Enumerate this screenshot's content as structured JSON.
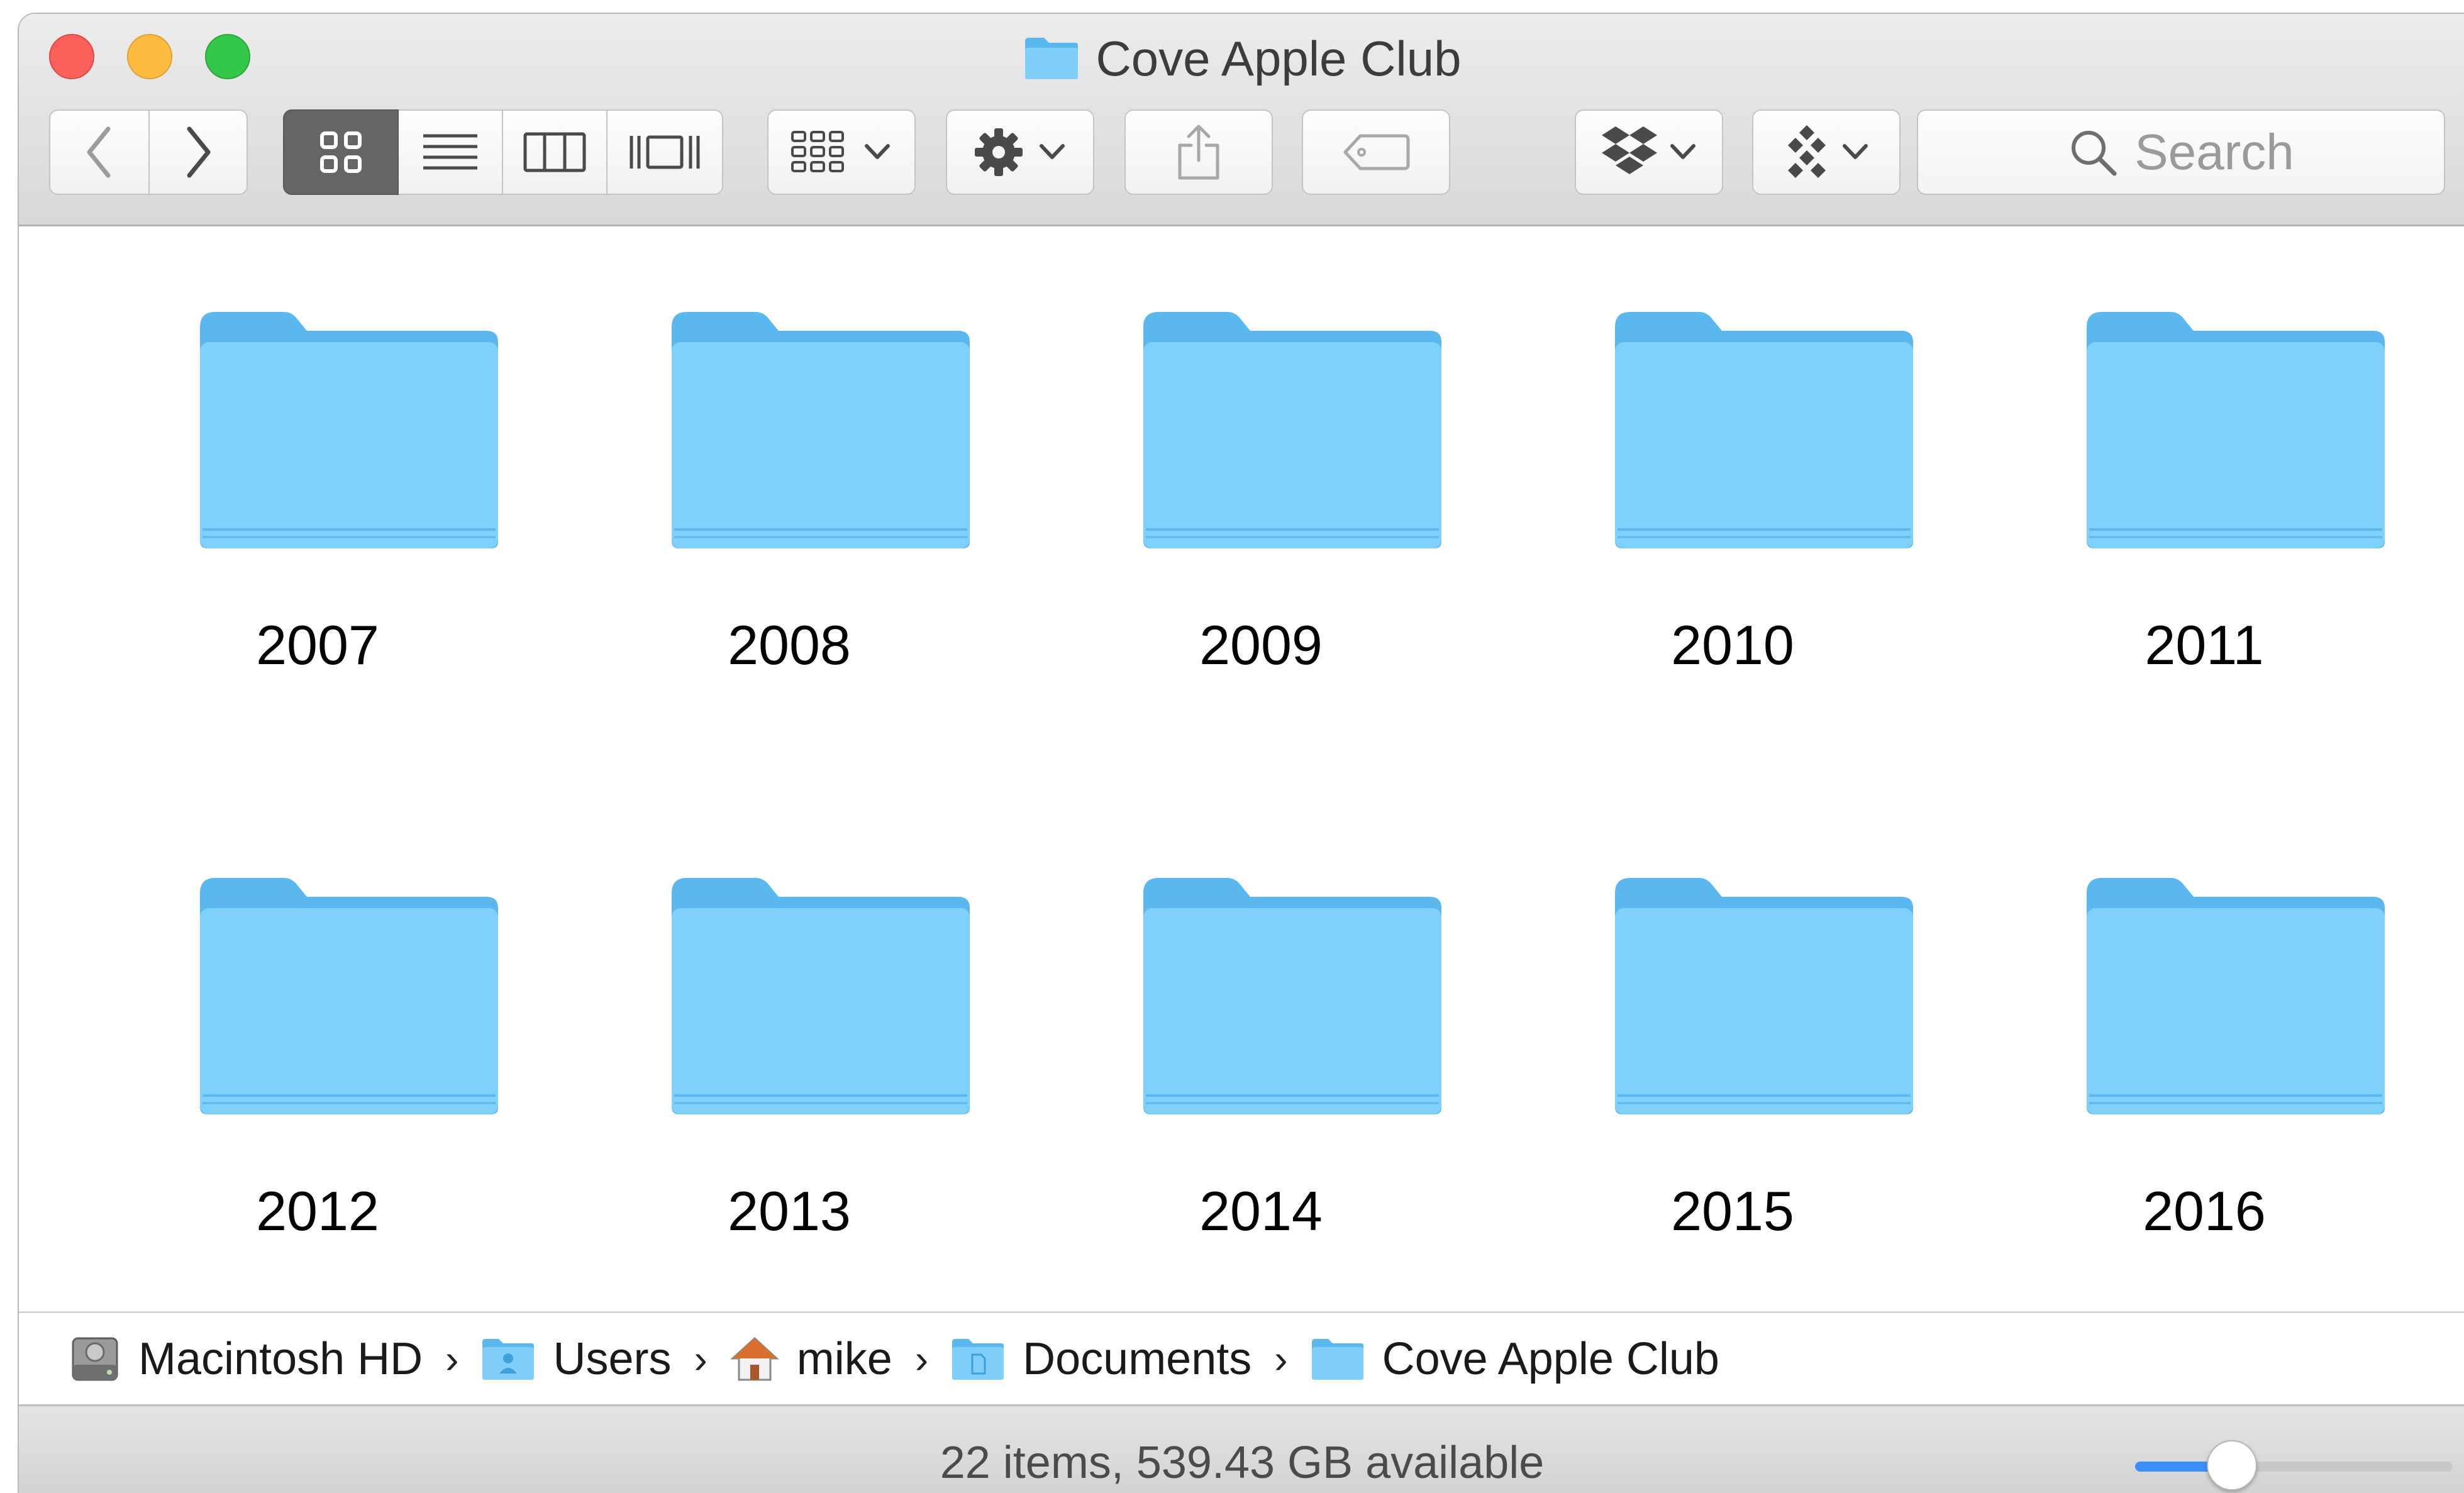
{
  "window": {
    "title": "Cove Apple Club"
  },
  "toolbar": {
    "back_icon": "chevron-left-icon",
    "forward_icon": "chevron-right-icon",
    "view_modes": [
      "icon-view",
      "list-view",
      "column-view",
      "coverflow-view"
    ],
    "active_view": "icon-view",
    "search_placeholder": "Search"
  },
  "folders": [
    {
      "name": "2007"
    },
    {
      "name": "2008"
    },
    {
      "name": "2009"
    },
    {
      "name": "2010"
    },
    {
      "name": "2011"
    },
    {
      "name": "2012"
    },
    {
      "name": "2013"
    },
    {
      "name": "2014"
    },
    {
      "name": "2015"
    },
    {
      "name": "2016"
    }
  ],
  "path": [
    {
      "label": "Macintosh HD",
      "icon": "hard-drive-icon"
    },
    {
      "label": "Users",
      "icon": "users-folder-icon"
    },
    {
      "label": "mike",
      "icon": "home-icon"
    },
    {
      "label": "Documents",
      "icon": "documents-folder-icon"
    },
    {
      "label": "Cove Apple Club",
      "icon": "folder-icon"
    }
  ],
  "status": {
    "text": "22 items, 539.43 GB available",
    "zoom_fraction": 0.3
  },
  "colors": {
    "folder_light": "#7fd0fb",
    "folder_dark": "#5ab8ee",
    "accent": "#3d8ef7"
  }
}
